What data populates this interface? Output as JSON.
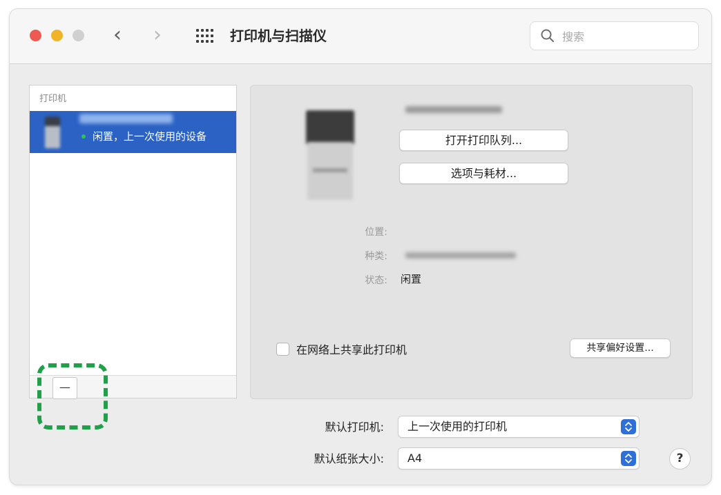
{
  "window": {
    "title": "打印机与扫描仪",
    "search_placeholder": "搜索"
  },
  "sidebar": {
    "header": "打印机",
    "printers": [
      {
        "status": "闲置，上一次使用的设备"
      }
    ],
    "remove_button_label": "—"
  },
  "detail": {
    "open_queue_label": "打开打印队列...",
    "options_label": "选项与耗材...",
    "location_label": "位置:",
    "kind_label": "种类:",
    "status_label": "状态:",
    "status_value": "闲置",
    "share_label": "在网络上共享此打印机",
    "share_prefs_label": "共享偏好设置..."
  },
  "settings": {
    "default_printer_label": "默认打印机:",
    "default_printer_value": "上一次使用的打印机",
    "paper_size_label": "默认纸张大小:",
    "paper_size_value": "A4",
    "help_label": "?"
  },
  "colors": {
    "selection": "#2b62c4",
    "status_idle": "#33c15a",
    "highlight": "#21a04a",
    "popup_accent": "#2e6fd8"
  }
}
